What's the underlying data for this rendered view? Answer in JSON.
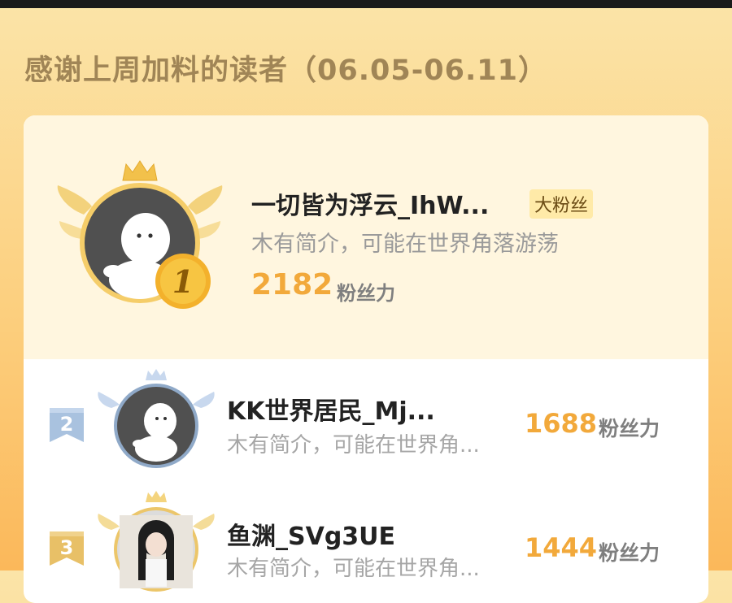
{
  "title": "感谢上周加料的读者（06.05-06.11）",
  "unit_label": "粉丝力",
  "top": {
    "rank": "1",
    "name": "一切皆为浮云_IhW...",
    "badge": "大粉丝",
    "bio": "木有简介，可能在世界角落游荡",
    "score": "2182"
  },
  "rows": [
    {
      "rank": "2",
      "name": "KK世界居民_Mj...",
      "bio": "木有简介，可能在世界角...",
      "score": "1688"
    },
    {
      "rank": "3",
      "name": "鱼渊_SVg3UE",
      "bio": "木有简介，可能在世界角...",
      "score": "1444"
    }
  ],
  "colors": {
    "gold": "#f2a93b",
    "silver": "#a9c2df",
    "bronze": "#e8c067"
  }
}
